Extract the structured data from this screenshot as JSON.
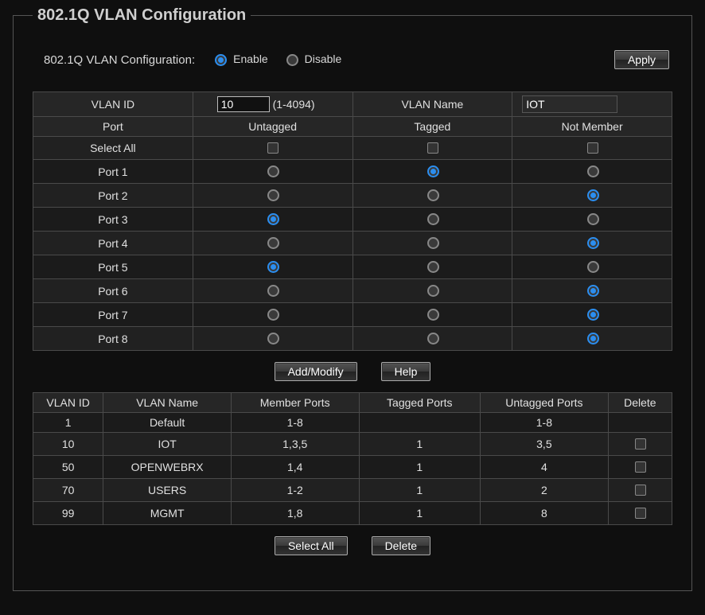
{
  "title": "802.1Q VLAN Configuration",
  "config": {
    "label": "802.1Q VLAN Configuration:",
    "enable_label": "Enable",
    "disable_label": "Disable",
    "selected": "enable",
    "apply_label": "Apply"
  },
  "editor": {
    "row1": {
      "vlan_id_hdr": "VLAN ID",
      "vlan_id_value": "10",
      "vlan_id_hint": "(1-4094)",
      "vlan_name_hdr": "VLAN Name",
      "vlan_name_value": "IOT"
    },
    "row2": {
      "port_hdr": "Port",
      "untagged_hdr": "Untagged",
      "tagged_hdr": "Tagged",
      "notmember_hdr": "Not Member"
    },
    "select_all_label": "Select All",
    "ports": [
      {
        "name": "Port 1",
        "sel": "tagged"
      },
      {
        "name": "Port 2",
        "sel": "notmember"
      },
      {
        "name": "Port 3",
        "sel": "untagged"
      },
      {
        "name": "Port 4",
        "sel": "notmember"
      },
      {
        "name": "Port 5",
        "sel": "untagged"
      },
      {
        "name": "Port 6",
        "sel": "notmember"
      },
      {
        "name": "Port 7",
        "sel": "notmember"
      },
      {
        "name": "Port 8",
        "sel": "notmember"
      }
    ],
    "add_modify_label": "Add/Modify",
    "help_label": "Help"
  },
  "list": {
    "headers": {
      "vlan_id": "VLAN ID",
      "vlan_name": "VLAN Name",
      "member_ports": "Member Ports",
      "tagged_ports": "Tagged Ports",
      "untagged_ports": "Untagged Ports",
      "delete": "Delete"
    },
    "rows": [
      {
        "id": "1",
        "name": "Default",
        "member": "1-8",
        "tagged": "",
        "untagged": "1-8",
        "no_delete": true
      },
      {
        "id": "10",
        "name": "IOT",
        "member": "1,3,5",
        "tagged": "1",
        "untagged": "3,5"
      },
      {
        "id": "50",
        "name": "OPENWEBRX",
        "member": "1,4",
        "tagged": "1",
        "untagged": "4"
      },
      {
        "id": "70",
        "name": "USERS",
        "member": "1-2",
        "tagged": "1",
        "untagged": "2"
      },
      {
        "id": "99",
        "name": "MGMT",
        "member": "1,8",
        "tagged": "1",
        "untagged": "8"
      }
    ],
    "select_all_label": "Select All",
    "delete_label": "Delete"
  }
}
